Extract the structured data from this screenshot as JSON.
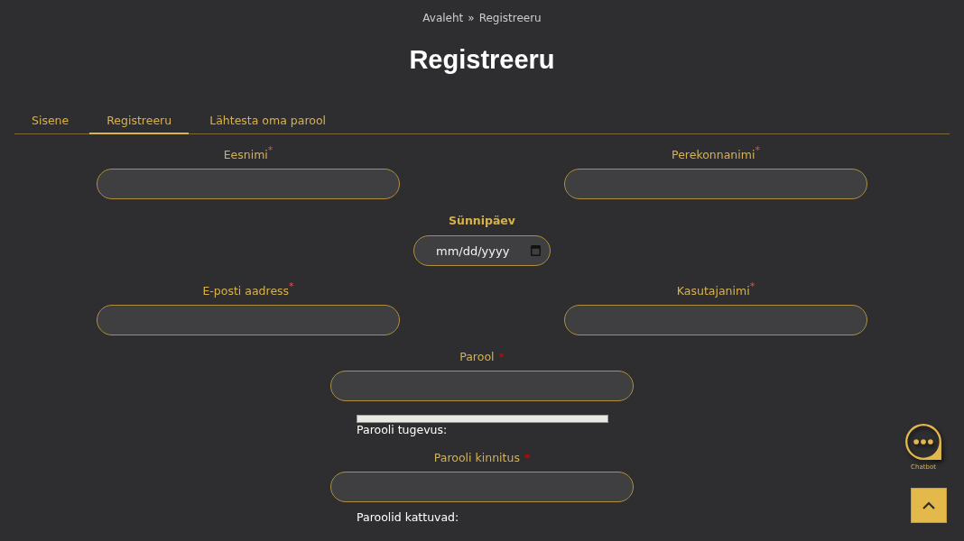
{
  "breadcrumb": {
    "items": [
      {
        "label": "Avaleht"
      },
      {
        "label": "Registreeru"
      }
    ],
    "separator": "»"
  },
  "title": "Registreeru",
  "tabs": [
    {
      "label": "Sisene",
      "selected": false
    },
    {
      "label": "Registreeru",
      "selected": true
    },
    {
      "label": "Lähtesta oma parool",
      "selected": false
    }
  ],
  "form": {
    "required_mark": "*",
    "rows": [
      {
        "fields": [
          {
            "kind": "text",
            "label": "Eesnimi",
            "required": true
          },
          {
            "kind": "text",
            "label": "Perekonnanimi",
            "required": true
          }
        ]
      },
      {
        "fields": [
          {
            "kind": "date",
            "label": "Sünnipäev",
            "required": false,
            "placeholder": "mm/dd/yyyy"
          }
        ]
      },
      {
        "fields": [
          {
            "kind": "text",
            "label": "E-posti aadress",
            "required": true
          },
          {
            "kind": "text",
            "label": "Kasutajanimi",
            "required": true
          }
        ]
      },
      {
        "fields": [
          {
            "kind": "password",
            "label": "Parool",
            "required": true,
            "hint": {
              "label": "Parooli tugevus:",
              "level": 0
            }
          }
        ]
      },
      {
        "fields": [
          {
            "kind": "password",
            "label": "Parooli kinnitus",
            "required": true,
            "hint": {
              "label": "Paroolid kattuvad:"
            }
          }
        ]
      }
    ]
  },
  "chatbot": {
    "label": "Chatbot"
  }
}
